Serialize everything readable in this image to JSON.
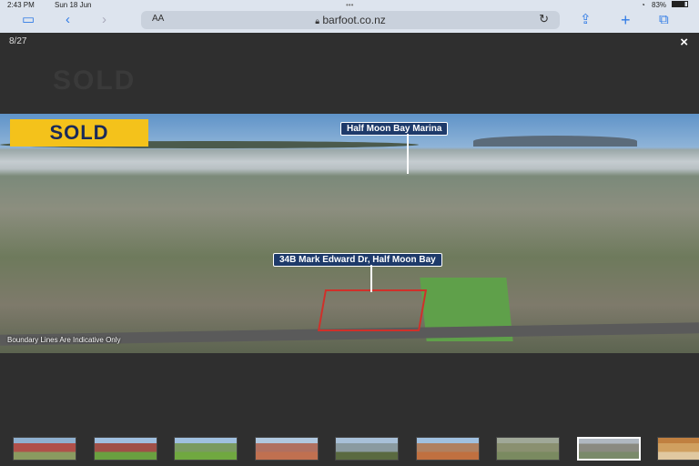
{
  "status": {
    "time": "2:43 PM",
    "date": "Sun 18 Jun",
    "battery": "83%"
  },
  "browser": {
    "text_size": "AA",
    "url": "barfoot.co.nz"
  },
  "viewer": {
    "counter": "8/27",
    "close": "×",
    "ghost_heading": "SOLD",
    "photo": {
      "badge": "SOLD",
      "label_marina": "Half Moon Bay Marina",
      "label_address": "34B Mark Edward Dr, Half Moon Bay",
      "note": "Boundary Lines Are Indicative Only"
    },
    "thumbnails": [
      {
        "colors": [
          "#8fb0d0",
          "#b0504a",
          "#8a9a60"
        ]
      },
      {
        "colors": [
          "#9fbfe0",
          "#a05048",
          "#6aa040"
        ]
      },
      {
        "colors": [
          "#a0c0e0",
          "#7a9a60",
          "#70a840"
        ]
      },
      {
        "colors": [
          "#b0c8e0",
          "#b07060",
          "#c07050"
        ]
      },
      {
        "colors": [
          "#a8c0d8",
          "#8a9aa0",
          "#5a6a40"
        ]
      },
      {
        "colors": [
          "#a0c0e0",
          "#b08060",
          "#c07040"
        ]
      },
      {
        "colors": [
          "#a0a898",
          "#8a9070",
          "#7a8a60"
        ]
      },
      {
        "colors": [
          "#b0b8c0",
          "#8a8a80",
          "#7a8a6a"
        ]
      },
      {
        "colors": [
          "#c08040",
          "#d0a060",
          "#e0c8a0"
        ]
      }
    ],
    "selected_thumbnail": 7
  }
}
